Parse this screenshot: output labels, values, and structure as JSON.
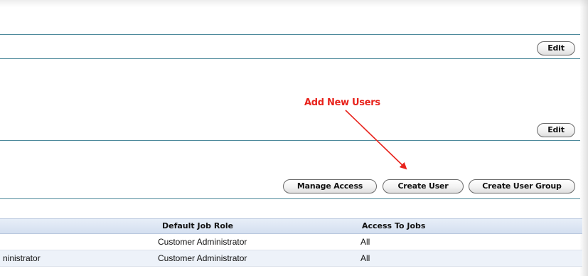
{
  "section1": {
    "edit_label": "Edit"
  },
  "section2": {
    "edit_label": "Edit"
  },
  "annotation": {
    "text": "Add New Users",
    "color": "#e8231c"
  },
  "toolbar": {
    "manage_access": "Manage Access",
    "create_user": "Create User",
    "create_user_group": "Create User Group"
  },
  "table": {
    "columns": [
      "",
      "Default Job Role",
      "Access To Jobs"
    ],
    "rows": [
      [
        "",
        "Customer Administrator",
        "All"
      ],
      [
        "ninistrator",
        "Customer Administrator",
        "All"
      ]
    ]
  },
  "colors": {
    "divider": "#4e8a9c",
    "header_bg": "#d4dff0",
    "alt_row_bg": "#edf2f9"
  }
}
